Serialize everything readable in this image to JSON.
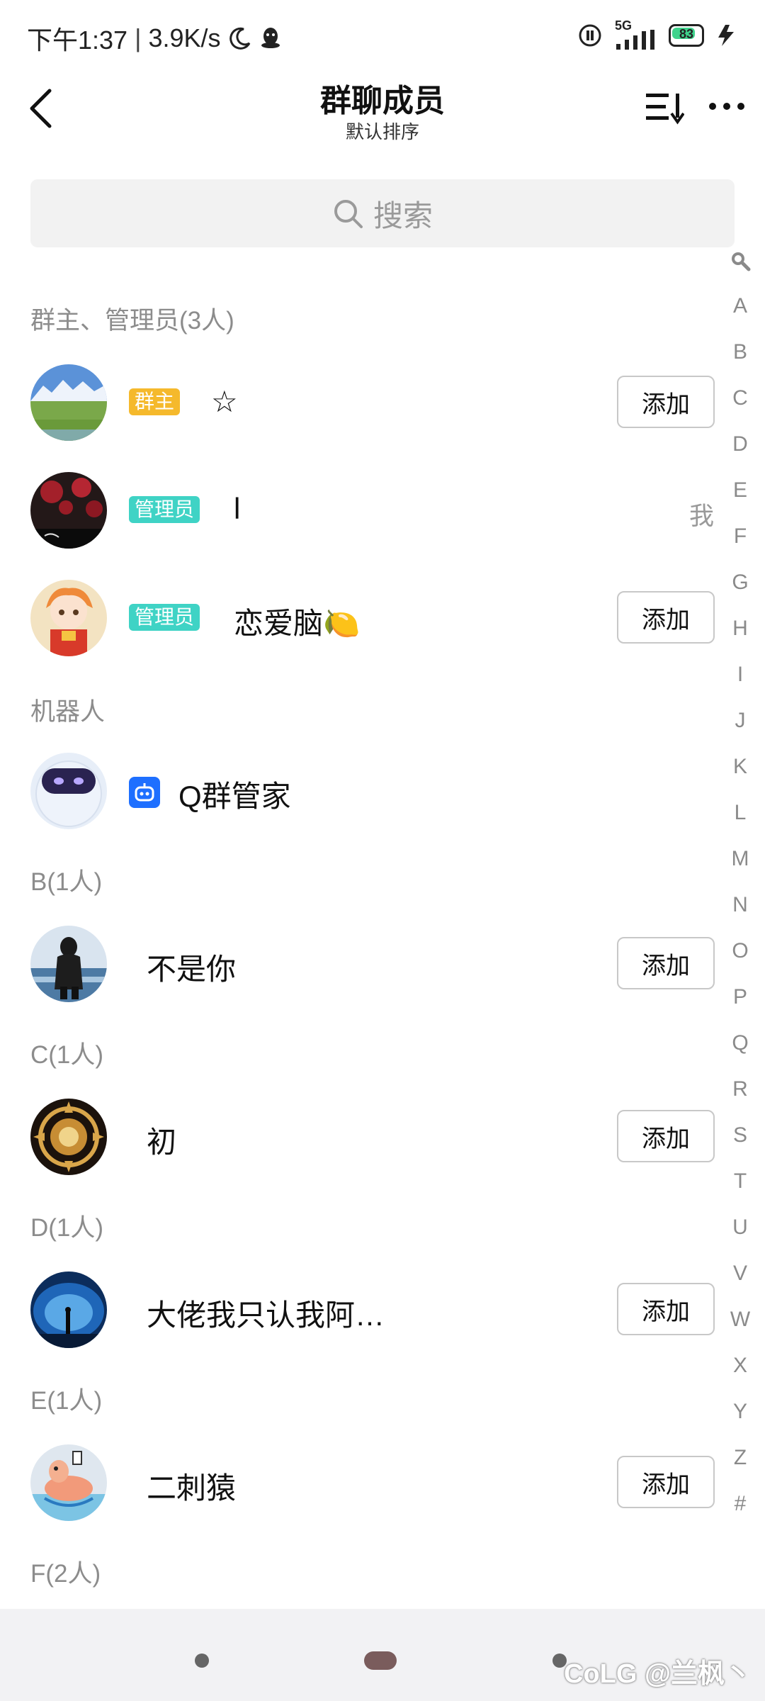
{
  "status": {
    "time": "下午1:37",
    "speed": "3.9K/s",
    "network": "5G",
    "battery": "83"
  },
  "header": {
    "title": "群聊成员",
    "subtitle": "默认排序"
  },
  "search": {
    "placeholder": "搜索"
  },
  "sections": {
    "admins": "群主、管理员(3人)",
    "robots": "机器人",
    "b": "B(1人)",
    "c": "C(1人)",
    "d": "D(1人)",
    "e": "E(1人)",
    "f": "F(2人)"
  },
  "members": {
    "owner": {
      "badge": "群主",
      "name": "☆",
      "action": "添加"
    },
    "admin1": {
      "badge": "管理员",
      "name": "l",
      "me": "我"
    },
    "admin2": {
      "badge": "管理员",
      "name": "恋爱脑🍋",
      "action": "添加"
    },
    "robot": {
      "name": "Q群管家"
    },
    "b1": {
      "name": "不是你",
      "action": "添加"
    },
    "c1": {
      "name": "初",
      "action": "添加"
    },
    "d1": {
      "name": "大佬我只认我阿…",
      "action": "添加"
    },
    "e1": {
      "name": "二刺猿",
      "action": "添加"
    }
  },
  "index": [
    "A",
    "B",
    "C",
    "D",
    "E",
    "F",
    "G",
    "H",
    "I",
    "J",
    "K",
    "L",
    "M",
    "N",
    "O",
    "P",
    "Q",
    "R",
    "S",
    "T",
    "U",
    "V",
    "W",
    "X",
    "Y",
    "Z",
    "#"
  ],
  "watermark": "CoLG @兰枫丶",
  "colors": {
    "owner_badge": "#f5b92c",
    "admin_badge": "#3fd3c5",
    "robot_icon": "#1e6fff"
  }
}
